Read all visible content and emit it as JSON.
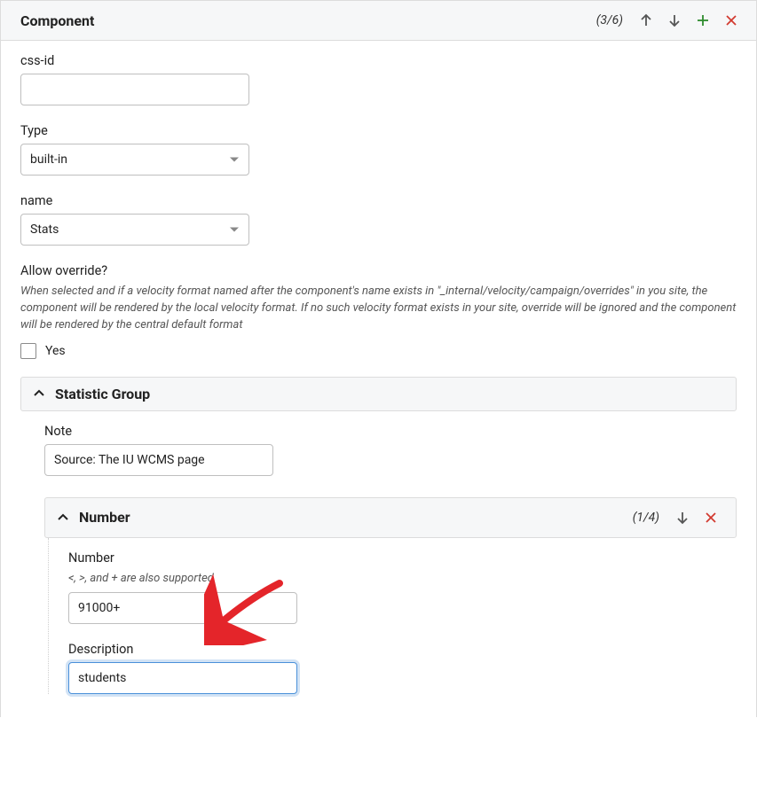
{
  "component": {
    "title": "Component",
    "count": "(3/6)",
    "cssid_label": "css-id",
    "cssid_value": "",
    "type_label": "Type",
    "type_value": "built-in",
    "name_label": "name",
    "name_value": "Stats",
    "override_label": "Allow override?",
    "override_help": "When selected and if a velocity format named after the component's name exists in \"_internal/velocity/campaign/overrides\" in you site, the component will be rendered by the local velocity format. If no such velocity format exists in your site, override will be ignored and the component will be rendered by the central default format",
    "override_checkbox_label": "Yes"
  },
  "stat_group": {
    "title": "Statistic Group",
    "note_label": "Note",
    "note_value": "Source: The IU WCMS page"
  },
  "number_section": {
    "title": "Number",
    "count": "(1/4)",
    "number_label": "Number",
    "number_help": "<, >, and + are also supported",
    "number_value": "91000+",
    "description_label": "Description",
    "description_value": "students"
  }
}
